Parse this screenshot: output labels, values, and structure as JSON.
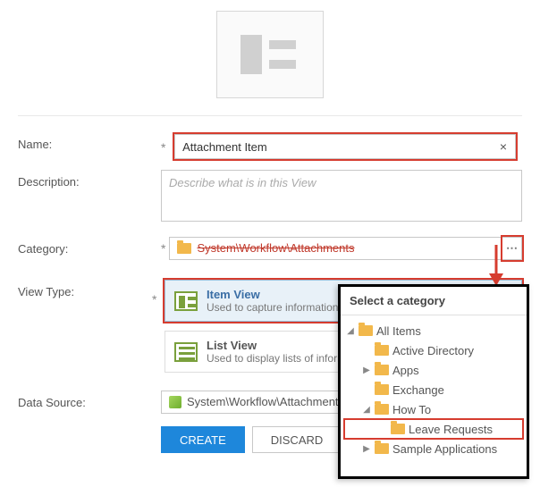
{
  "labels": {
    "name": "Name:",
    "description": "Description:",
    "category": "Category:",
    "viewType": "View Type:",
    "dataSource": "Data Source:"
  },
  "name": {
    "value": "Attachment Item"
  },
  "description": {
    "placeholder": "Describe what is in this View",
    "value": ""
  },
  "category": {
    "path": "System\\Workflow\\Attachments"
  },
  "viewTypes": {
    "item": {
      "title": "Item View",
      "sub": "Used to capture information."
    },
    "list": {
      "title": "List View",
      "sub": "Used to display lists of information."
    }
  },
  "dataSource": {
    "path": "System\\Workflow\\Attachments\\Workflow Attachments"
  },
  "buttons": {
    "create": "CREATE",
    "discard": "DISCARD"
  },
  "popup": {
    "title": "Select a category",
    "tree": {
      "root": "All Items",
      "n0": "Active Directory",
      "n1": "Apps",
      "n2": "Exchange",
      "n3": "How To",
      "n3_0": "Leave Requests",
      "n4": "Sample Applications"
    }
  }
}
